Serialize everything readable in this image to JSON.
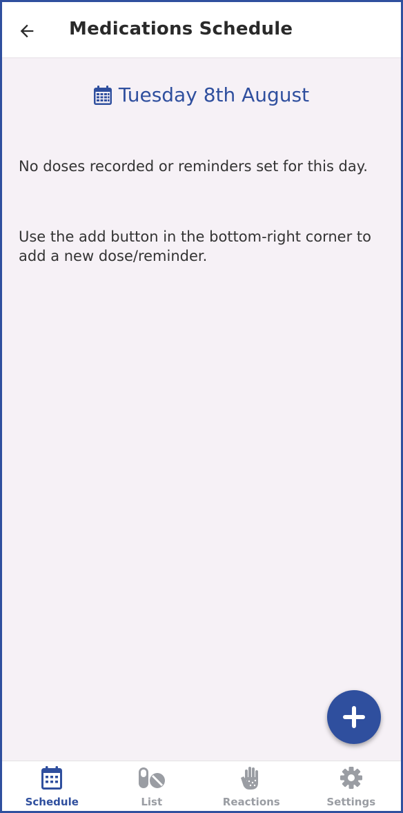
{
  "header": {
    "title": "Medications Schedule",
    "back_icon": "arrow-left-icon"
  },
  "date_selector": {
    "icon": "calendar-icon",
    "label": "Tuesday 8th August"
  },
  "empty_state": {
    "message_1": "No doses recorded or reminders set for this day.",
    "message_2": "Use the add button in the bottom-right corner to add a new dose/reminder."
  },
  "fab": {
    "icon": "plus-icon"
  },
  "bottom_nav": {
    "items": [
      {
        "label": "Schedule",
        "icon": "calendar-icon",
        "active": true
      },
      {
        "label": "List",
        "icon": "pills-icon",
        "active": false
      },
      {
        "label": "Reactions",
        "icon": "hand-icon",
        "active": false
      },
      {
        "label": "Settings",
        "icon": "gear-icon",
        "active": false
      }
    ]
  },
  "colors": {
    "accent": "#2f4f9e",
    "background": "#f6f1f6",
    "inactive": "#9a9da3"
  }
}
